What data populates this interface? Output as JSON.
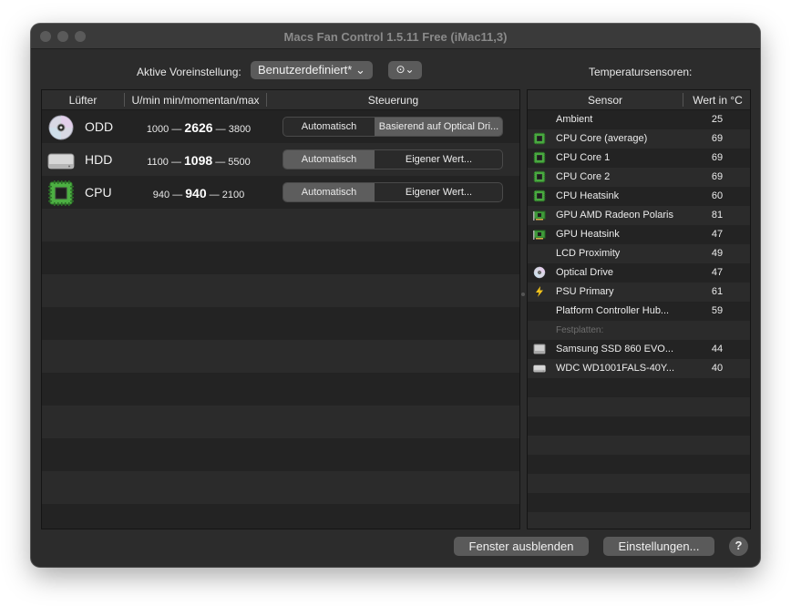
{
  "window": {
    "title": "Macs Fan Control 1.5.11 Free (iMac11,3)"
  },
  "preset": {
    "label": "Aktive Voreinstellung:",
    "value": "Benutzerdefiniert* ⌄",
    "more_label": "⊙⌄"
  },
  "fans_table": {
    "headers": {
      "fan": "Lüfter",
      "rpm": "U/min min/momentan/max",
      "control": "Steuerung"
    },
    "rows": [
      {
        "name": "ODD",
        "icon": "optical-disc-icon",
        "min": "1000",
        "current": "2626",
        "max": "3800",
        "sep": "—",
        "auto_label": "Automatisch",
        "custom_label": "Basierend auf Optical Dri...",
        "selected": "custom"
      },
      {
        "name": "HDD",
        "icon": "hard-drive-icon",
        "min": "1100",
        "current": "1098",
        "max": "5500",
        "sep": "—",
        "auto_label": "Automatisch",
        "custom_label": "Eigener Wert...",
        "selected": "auto"
      },
      {
        "name": "CPU",
        "icon": "cpu-chip-icon",
        "min": "940",
        "current": "940",
        "max": "2100",
        "sep": "—",
        "auto_label": "Automatisch",
        "custom_label": "Eigener Wert...",
        "selected": "auto"
      }
    ]
  },
  "sensors": {
    "title": "Temperatursensoren:",
    "headers": {
      "sensor": "Sensor",
      "value": "Wert in °C"
    },
    "rows": [
      {
        "name": "Ambient",
        "value": "25",
        "icon": "none"
      },
      {
        "name": "CPU Core (average)",
        "value": "69",
        "icon": "cpu-chip-icon"
      },
      {
        "name": "CPU Core 1",
        "value": "69",
        "icon": "cpu-chip-icon"
      },
      {
        "name": "CPU Core 2",
        "value": "69",
        "icon": "cpu-chip-icon"
      },
      {
        "name": "CPU Heatsink",
        "value": "60",
        "icon": "cpu-chip-icon"
      },
      {
        "name": "GPU AMD Radeon Polaris",
        "value": "81",
        "icon": "gpu-card-icon"
      },
      {
        "name": "GPU Heatsink",
        "value": "47",
        "icon": "gpu-card-icon"
      },
      {
        "name": "LCD Proximity",
        "value": "49",
        "icon": "none"
      },
      {
        "name": "Optical Drive",
        "value": "47",
        "icon": "optical-disc-icon"
      },
      {
        "name": "PSU Primary",
        "value": "61",
        "icon": "lightning-icon"
      },
      {
        "name": "Platform Controller Hub...",
        "value": "59",
        "icon": "none"
      }
    ],
    "group_label": "Festplatten:",
    "disk_rows": [
      {
        "name": "Samsung SSD 860 EVO...",
        "value": "44",
        "icon": "ssd-icon"
      },
      {
        "name": "WDC WD1001FALS-40Y...",
        "value": "40",
        "icon": "hard-drive-icon"
      }
    ]
  },
  "buttons": {
    "hide": "Fenster ausblenden",
    "settings": "Einstellungen...",
    "help": "?"
  },
  "colors": {
    "window_bg": "#2c2c2c",
    "panel_bg": "#232323",
    "row_alt": "#2b2b2b",
    "chip_green": "#3f9a3a",
    "selected_segment": "#5d5d5d"
  }
}
